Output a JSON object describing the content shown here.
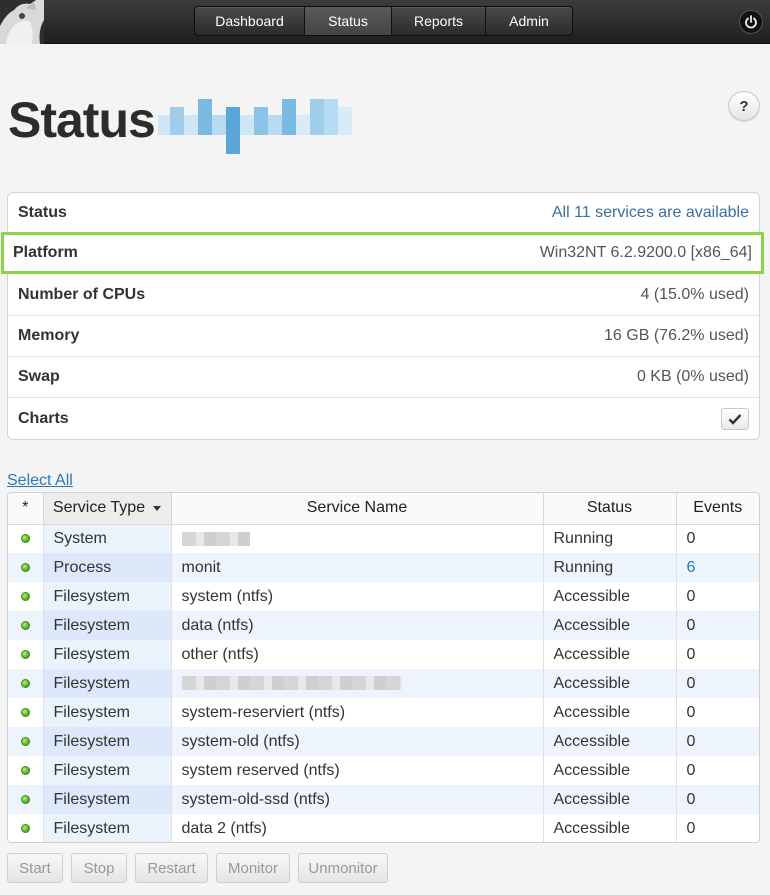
{
  "nav": {
    "items": [
      {
        "label": "Dashboard",
        "active": false
      },
      {
        "label": "Status",
        "active": true
      },
      {
        "label": "Reports",
        "active": false
      },
      {
        "label": "Admin",
        "active": false
      }
    ]
  },
  "header": {
    "title": "Status",
    "help_label": "?"
  },
  "info": {
    "status": {
      "label": "Status",
      "value": "All 11 services are available"
    },
    "platform": {
      "label": "Platform",
      "value": "Win32NT 6.2.9200.0 [x86_64]"
    },
    "cpus": {
      "label": "Number of CPUs",
      "value": "4 (15.0% used)"
    },
    "memory": {
      "label": "Memory",
      "value": "16 GB (76.2% used)"
    },
    "swap": {
      "label": "Swap",
      "value": "0 KB (0% used)"
    },
    "charts": {
      "label": "Charts",
      "checked": true
    }
  },
  "services": {
    "select_all": "Select All",
    "columns": [
      "*",
      "Service Type",
      "Service Name",
      "Status",
      "Events"
    ],
    "rows": [
      {
        "type": "System",
        "name": "",
        "status": "Running",
        "events": "0"
      },
      {
        "type": "Process",
        "name": "monit",
        "status": "Running",
        "events": "6"
      },
      {
        "type": "Filesystem",
        "name": "system (ntfs)",
        "status": "Accessible",
        "events": "0"
      },
      {
        "type": "Filesystem",
        "name": "data (ntfs)",
        "status": "Accessible",
        "events": "0"
      },
      {
        "type": "Filesystem",
        "name": "other (ntfs)",
        "status": "Accessible",
        "events": "0"
      },
      {
        "type": "Filesystem",
        "name": "",
        "status": "Accessible",
        "events": "0"
      },
      {
        "type": "Filesystem",
        "name": "system-reserviert (ntfs)",
        "status": "Accessible",
        "events": "0"
      },
      {
        "type": "Filesystem",
        "name": "system-old (ntfs)",
        "status": "Accessible",
        "events": "0"
      },
      {
        "type": "Filesystem",
        "name": "system reserved (ntfs)",
        "status": "Accessible",
        "events": "0"
      },
      {
        "type": "Filesystem",
        "name": "system-old-ssd (ntfs)",
        "status": "Accessible",
        "events": "0"
      },
      {
        "type": "Filesystem",
        "name": "data 2 (ntfs)",
        "status": "Accessible",
        "events": "0"
      }
    ]
  },
  "actions": [
    "Start",
    "Stop",
    "Restart",
    "Monitor",
    "Unmonitor"
  ],
  "colors": {
    "accent": "#2a7ab8",
    "highlight_border": "#8ed44a",
    "running_dot": "#4ea51f"
  }
}
